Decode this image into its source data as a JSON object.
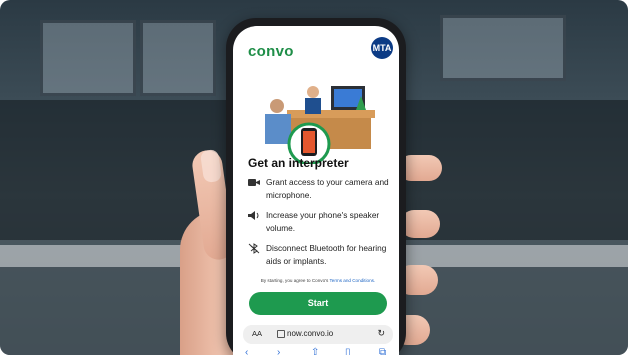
{
  "app": {
    "logo_text": "convo",
    "brand_badge": "MTA"
  },
  "heading": "Get an interpreter",
  "instructions": [
    {
      "icon": "video-camera-icon",
      "text": "Grant access to your camera and microphone."
    },
    {
      "icon": "speaker-icon",
      "text": "Increase your phone's speaker volume."
    },
    {
      "icon": "bluetooth-off-icon",
      "text": "Disconnect Bluetooth for hearing aids or implants."
    }
  ],
  "consent": {
    "prefix": "By starting, you agree to Convo's ",
    "link": "Terms and Conditions."
  },
  "start_button": "Start",
  "browser": {
    "text_size_label": "AA",
    "url": "now.convo.io",
    "reload_icon": "reload-icon"
  },
  "colors": {
    "brand_green": "#1e9a4f",
    "mta_blue": "#0c3b85",
    "link_blue": "#1f66c4"
  }
}
